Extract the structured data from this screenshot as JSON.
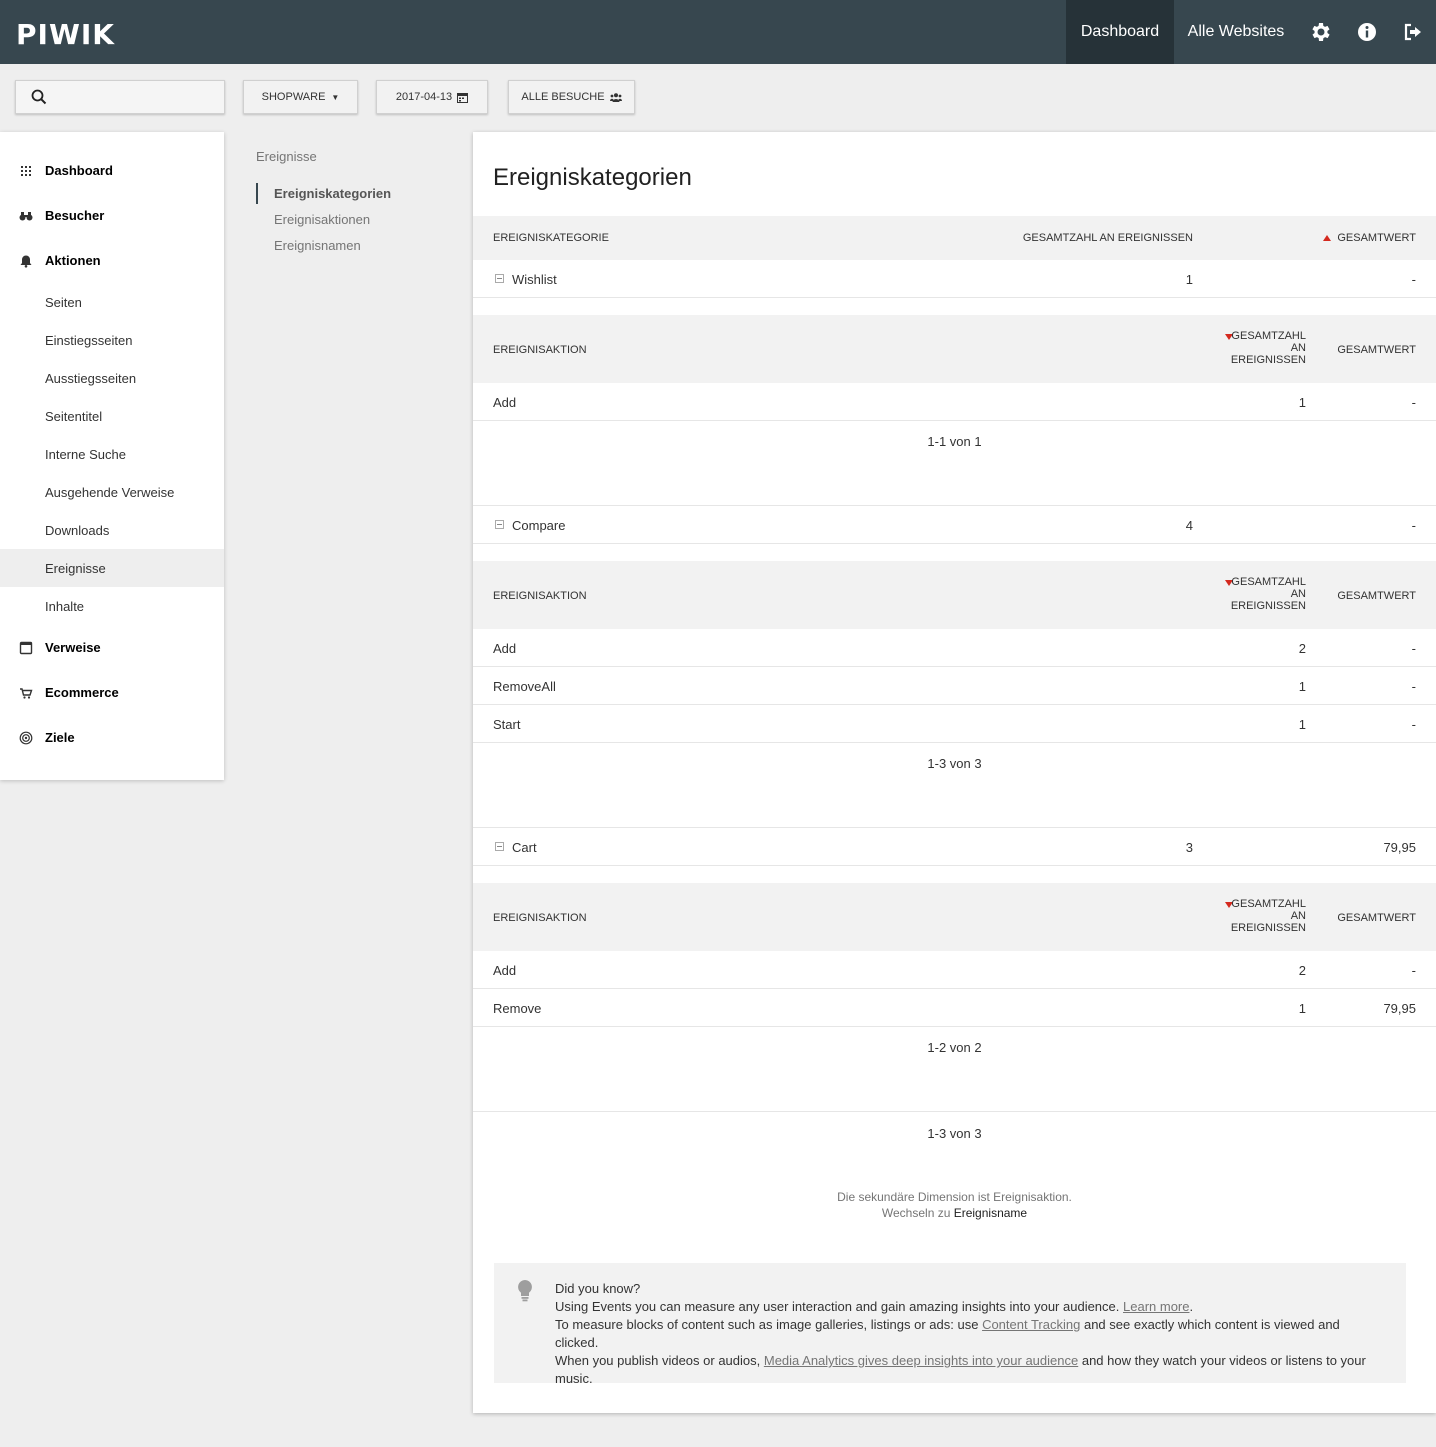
{
  "header": {
    "logo": "PIWIK",
    "nav": {
      "dashboard": "Dashboard",
      "all_websites": "Alle Websites"
    }
  },
  "toolbar": {
    "search_value": "",
    "site": "SHOPWARE",
    "date": "2017-04-13",
    "segment": "ALLE BESUCHE"
  },
  "sidebar": {
    "categories": {
      "dashboard": "Dashboard",
      "besucher": "Besucher",
      "aktionen": "Aktionen",
      "verweise": "Verweise",
      "ecommerce": "Ecommerce",
      "ziele": "Ziele"
    },
    "aktionen_items": [
      "Seiten",
      "Einstiegsseiten",
      "Ausstiegsseiten",
      "Seitentitel",
      "Interne Suche",
      "Ausgehende Verweise",
      "Downloads",
      "Ereignisse",
      "Inhalte"
    ]
  },
  "submenu": {
    "title": "Ereignisse",
    "items": [
      "Ereigniskategorien",
      "Ereignisaktionen",
      "Ereignisnamen"
    ]
  },
  "report": {
    "title": "Ereigniskategorien",
    "columns": {
      "category": "EREIGNISKATEGORIE",
      "total": "GESAMTZAHL AN EREIGNISSEN",
      "value": "GESAMTWERT"
    },
    "sub_columns": {
      "action": "EREIGNISAKTION",
      "total_l1": "GESAMTZAHL",
      "total_l2": "AN",
      "total_l3": "EREIGNISSEN",
      "value": "GESAMTWERT"
    },
    "categories": [
      {
        "name": "Wishlist",
        "total": "1",
        "value": "-",
        "actions": [
          {
            "name": "Add",
            "total": "1",
            "value": "-"
          }
        ],
        "pager": "1-1 von 1"
      },
      {
        "name": "Compare",
        "total": "4",
        "value": "-",
        "actions": [
          {
            "name": "Add",
            "total": "2",
            "value": "-"
          },
          {
            "name": "RemoveAll",
            "total": "1",
            "value": "-"
          },
          {
            "name": "Start",
            "total": "1",
            "value": "-"
          }
        ],
        "pager": "1-3 von 3"
      },
      {
        "name": "Cart",
        "total": "3",
        "value": "79,95",
        "actions": [
          {
            "name": "Add",
            "total": "2",
            "value": "-"
          },
          {
            "name": "Remove",
            "total": "1",
            "value": "79,95"
          }
        ],
        "pager": "1-2 von 2"
      }
    ],
    "pager": "1-3 von 3",
    "dimension_note": "Die sekundäre Dimension ist Ereignisaktion.",
    "switch_prefix": "Wechseln zu",
    "switch_link": "Ereignisname"
  },
  "tip": {
    "heading": "Did you know?",
    "line1": "Using Events you can measure any user interaction and gain amazing insights into your audience.",
    "line1_link": "Learn more",
    "line2_a": "To measure blocks of content such as image galleries, listings or ads: use",
    "line2_link": "Content Tracking",
    "line2_b": "and see exactly which content is viewed and clicked.",
    "line3_a": "When you publish videos or audios,",
    "line3_link": "Media Analytics gives deep insights into your audience",
    "line3_b": "and how they watch your videos or listens to your music."
  }
}
